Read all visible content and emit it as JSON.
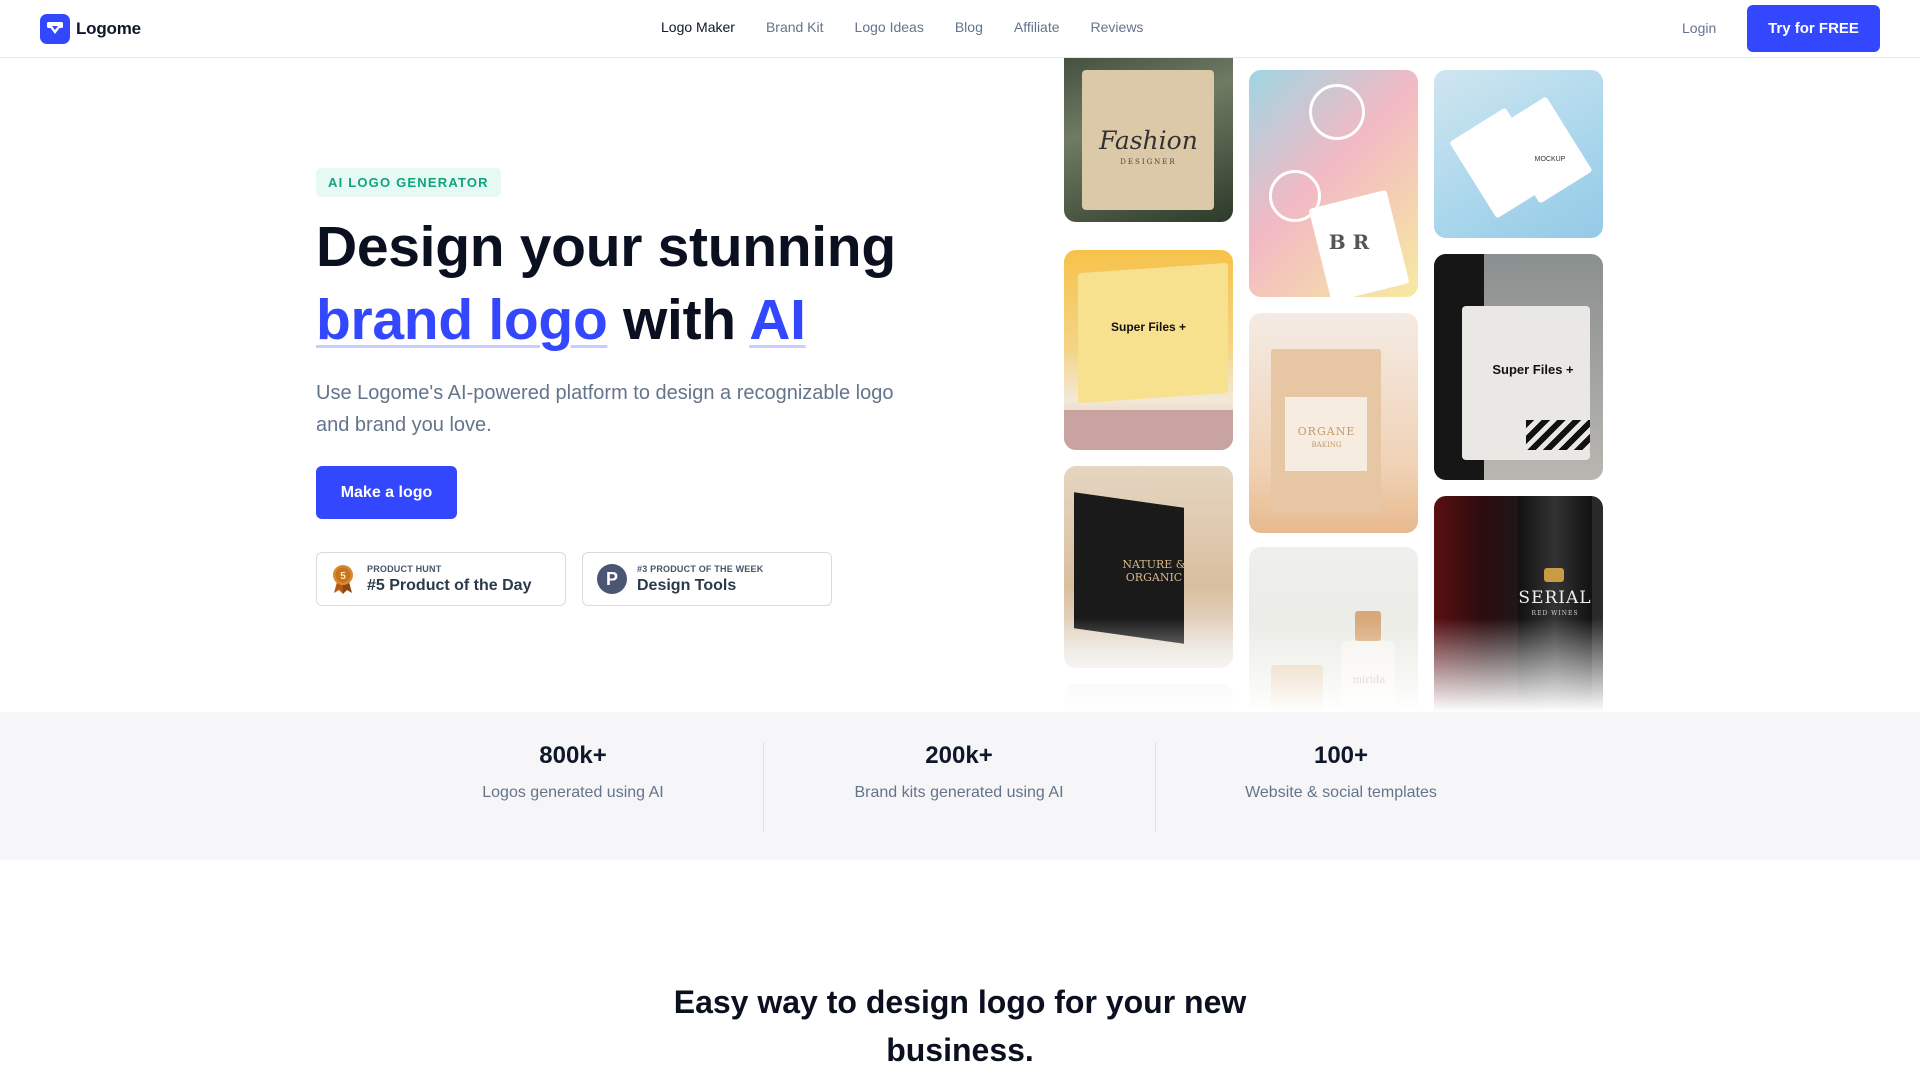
{
  "header": {
    "brand": "Logome",
    "nav": [
      "Logo Maker",
      "Brand Kit",
      "Logo Ideas",
      "Blog",
      "Affiliate",
      "Reviews"
    ],
    "login": "Login",
    "cta": "Try for FREE"
  },
  "hero": {
    "eyebrow": "AI LOGO GENERATOR",
    "headline_line1": "Design your stunning",
    "headline_accent1": "brand logo",
    "headline_with": "with",
    "headline_accent2": "AI",
    "subtitle": "Use Logome's AI-powered platform to design a recognizable logo and brand you love.",
    "button": "Make a logo",
    "badges": [
      {
        "small": "PRODUCT HUNT",
        "big": "#5 Product of the Day",
        "icon": "medal-icon",
        "medal_number": "5"
      },
      {
        "small": "#3 PRODUCT OF THE WEEK",
        "big": "Design Tools",
        "icon": "product-hunt-icon",
        "letter": "P"
      }
    ]
  },
  "gallery": {
    "tiles": [
      {
        "text": "Fashion",
        "sub": "DESIGNER"
      },
      {
        "text": "Super Files +"
      },
      {
        "text": "NATURE & ORGANIC"
      },
      {
        "text": "B R"
      },
      {
        "text": "ORGANE",
        "sub": "BAKING"
      },
      {
        "text": "mirida"
      },
      {
        "text": "MOCKUP"
      },
      {
        "text": "Super Files +"
      },
      {
        "text": "SERIAL",
        "sub": "RED WINES"
      }
    ]
  },
  "stats": [
    {
      "value": "800k+",
      "label": "Logos generated using AI"
    },
    {
      "value": "200k+",
      "label": "Brand kits generated using AI"
    },
    {
      "value": "100+",
      "label": "Website & social templates"
    }
  ],
  "section": {
    "title": "Easy way to design logo for your new business."
  }
}
